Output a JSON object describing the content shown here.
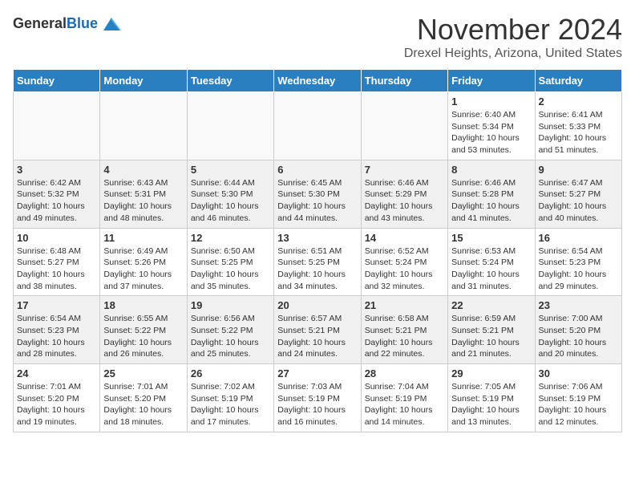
{
  "header": {
    "logo_general": "General",
    "logo_blue": "Blue",
    "month_title": "November 2024",
    "location": "Drexel Heights, Arizona, United States"
  },
  "days_of_week": [
    "Sunday",
    "Monday",
    "Tuesday",
    "Wednesday",
    "Thursday",
    "Friday",
    "Saturday"
  ],
  "weeks": [
    [
      {
        "day": "",
        "empty": true
      },
      {
        "day": "",
        "empty": true
      },
      {
        "day": "",
        "empty": true
      },
      {
        "day": "",
        "empty": true
      },
      {
        "day": "",
        "empty": true
      },
      {
        "day": "1",
        "sunrise": "6:40 AM",
        "sunset": "5:34 PM",
        "daylight": "10 hours and 53 minutes."
      },
      {
        "day": "2",
        "sunrise": "6:41 AM",
        "sunset": "5:33 PM",
        "daylight": "10 hours and 51 minutes."
      }
    ],
    [
      {
        "day": "3",
        "sunrise": "6:42 AM",
        "sunset": "5:32 PM",
        "daylight": "10 hours and 49 minutes."
      },
      {
        "day": "4",
        "sunrise": "6:43 AM",
        "sunset": "5:31 PM",
        "daylight": "10 hours and 48 minutes."
      },
      {
        "day": "5",
        "sunrise": "6:44 AM",
        "sunset": "5:30 PM",
        "daylight": "10 hours and 46 minutes."
      },
      {
        "day": "6",
        "sunrise": "6:45 AM",
        "sunset": "5:30 PM",
        "daylight": "10 hours and 44 minutes."
      },
      {
        "day": "7",
        "sunrise": "6:46 AM",
        "sunset": "5:29 PM",
        "daylight": "10 hours and 43 minutes."
      },
      {
        "day": "8",
        "sunrise": "6:46 AM",
        "sunset": "5:28 PM",
        "daylight": "10 hours and 41 minutes."
      },
      {
        "day": "9",
        "sunrise": "6:47 AM",
        "sunset": "5:27 PM",
        "daylight": "10 hours and 40 minutes."
      }
    ],
    [
      {
        "day": "10",
        "sunrise": "6:48 AM",
        "sunset": "5:27 PM",
        "daylight": "10 hours and 38 minutes."
      },
      {
        "day": "11",
        "sunrise": "6:49 AM",
        "sunset": "5:26 PM",
        "daylight": "10 hours and 37 minutes."
      },
      {
        "day": "12",
        "sunrise": "6:50 AM",
        "sunset": "5:25 PM",
        "daylight": "10 hours and 35 minutes."
      },
      {
        "day": "13",
        "sunrise": "6:51 AM",
        "sunset": "5:25 PM",
        "daylight": "10 hours and 34 minutes."
      },
      {
        "day": "14",
        "sunrise": "6:52 AM",
        "sunset": "5:24 PM",
        "daylight": "10 hours and 32 minutes."
      },
      {
        "day": "15",
        "sunrise": "6:53 AM",
        "sunset": "5:24 PM",
        "daylight": "10 hours and 31 minutes."
      },
      {
        "day": "16",
        "sunrise": "6:54 AM",
        "sunset": "5:23 PM",
        "daylight": "10 hours and 29 minutes."
      }
    ],
    [
      {
        "day": "17",
        "sunrise": "6:54 AM",
        "sunset": "5:23 PM",
        "daylight": "10 hours and 28 minutes."
      },
      {
        "day": "18",
        "sunrise": "6:55 AM",
        "sunset": "5:22 PM",
        "daylight": "10 hours and 26 minutes."
      },
      {
        "day": "19",
        "sunrise": "6:56 AM",
        "sunset": "5:22 PM",
        "daylight": "10 hours and 25 minutes."
      },
      {
        "day": "20",
        "sunrise": "6:57 AM",
        "sunset": "5:21 PM",
        "daylight": "10 hours and 24 minutes."
      },
      {
        "day": "21",
        "sunrise": "6:58 AM",
        "sunset": "5:21 PM",
        "daylight": "10 hours and 22 minutes."
      },
      {
        "day": "22",
        "sunrise": "6:59 AM",
        "sunset": "5:21 PM",
        "daylight": "10 hours and 21 minutes."
      },
      {
        "day": "23",
        "sunrise": "7:00 AM",
        "sunset": "5:20 PM",
        "daylight": "10 hours and 20 minutes."
      }
    ],
    [
      {
        "day": "24",
        "sunrise": "7:01 AM",
        "sunset": "5:20 PM",
        "daylight": "10 hours and 19 minutes."
      },
      {
        "day": "25",
        "sunrise": "7:01 AM",
        "sunset": "5:20 PM",
        "daylight": "10 hours and 18 minutes."
      },
      {
        "day": "26",
        "sunrise": "7:02 AM",
        "sunset": "5:19 PM",
        "daylight": "10 hours and 17 minutes."
      },
      {
        "day": "27",
        "sunrise": "7:03 AM",
        "sunset": "5:19 PM",
        "daylight": "10 hours and 16 minutes."
      },
      {
        "day": "28",
        "sunrise": "7:04 AM",
        "sunset": "5:19 PM",
        "daylight": "10 hours and 14 minutes."
      },
      {
        "day": "29",
        "sunrise": "7:05 AM",
        "sunset": "5:19 PM",
        "daylight": "10 hours and 13 minutes."
      },
      {
        "day": "30",
        "sunrise": "7:06 AM",
        "sunset": "5:19 PM",
        "daylight": "10 hours and 12 minutes."
      }
    ]
  ]
}
